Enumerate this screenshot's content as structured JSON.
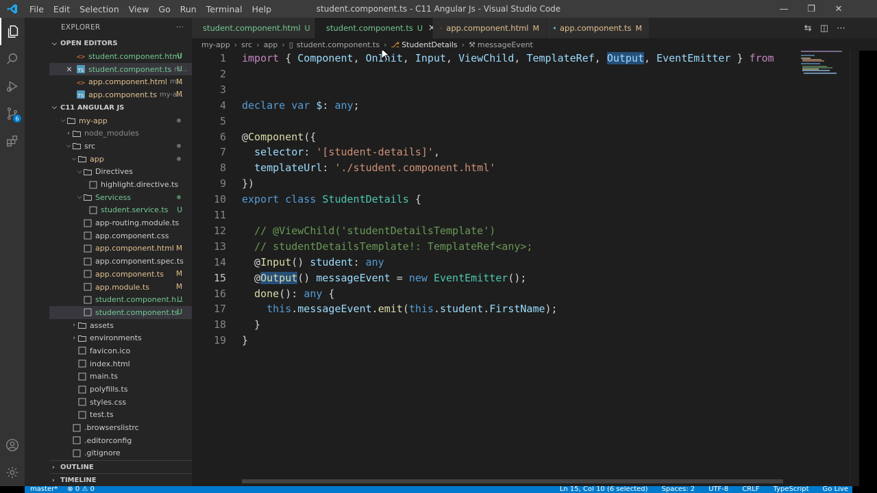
{
  "window": {
    "title": "student.component.ts - C11 Angular Js - Visual Studio Code",
    "menu": [
      "File",
      "Edit",
      "Selection",
      "View",
      "Go",
      "Run",
      "Terminal",
      "Help"
    ]
  },
  "activity": {
    "items": [
      "files-icon",
      "search-icon",
      "run-debug-icon",
      "source-control-icon",
      "extensions-icon"
    ],
    "scm_badge": "6"
  },
  "sidebar": {
    "title": "EXPLORER",
    "more": "···",
    "open_editors": {
      "label": "OPEN EDITORS",
      "items": [
        {
          "name": "student.component.html",
          "desc": "",
          "status": "U"
        },
        {
          "name": "student.component.ts",
          "desc": "m...",
          "status": "U"
        },
        {
          "name": "app.component.html",
          "desc": "m...",
          "status": "M"
        },
        {
          "name": "app.component.ts",
          "desc": "my-a...",
          "status": "M"
        }
      ]
    },
    "workspace": {
      "label": "C11 ANGULAR JS",
      "tree": [
        {
          "name": "my-app",
          "status": ""
        },
        {
          "name": "node_modules",
          "status": ""
        },
        {
          "name": "src",
          "status": ""
        },
        {
          "name": "app",
          "status": ""
        },
        {
          "name": "Directives",
          "status": ""
        },
        {
          "name": "highlight.directive.ts",
          "status": ""
        },
        {
          "name": "Servicess",
          "status": ""
        },
        {
          "name": "student.service.ts",
          "status": "U"
        },
        {
          "name": "app-routing.module.ts",
          "status": ""
        },
        {
          "name": "app.component.css",
          "status": ""
        },
        {
          "name": "app.component.html",
          "status": "M"
        },
        {
          "name": "app.component.spec.ts",
          "status": ""
        },
        {
          "name": "app.component.ts",
          "status": "M"
        },
        {
          "name": "app.module.ts",
          "status": "M"
        },
        {
          "name": "student.component.h...",
          "status": "U"
        },
        {
          "name": "student.component.ts",
          "status": "U"
        },
        {
          "name": "assets",
          "status": ""
        },
        {
          "name": "environments",
          "status": ""
        },
        {
          "name": "favicon.ico",
          "status": ""
        },
        {
          "name": "index.html",
          "status": ""
        },
        {
          "name": "main.ts",
          "status": ""
        },
        {
          "name": "polyfills.ts",
          "status": ""
        },
        {
          "name": "styles.css",
          "status": ""
        },
        {
          "name": "test.ts",
          "status": ""
        },
        {
          "name": ".browserslistrc",
          "status": ""
        },
        {
          "name": ".editorconfig",
          "status": ""
        },
        {
          "name": ".gitignore",
          "status": ""
        }
      ]
    },
    "outline": "OUTLINE",
    "timeline": "TIMELINE"
  },
  "tabs": [
    {
      "label": "student.component.html",
      "flag": "U"
    },
    {
      "label": "student.component.ts",
      "flag": "U"
    },
    {
      "label": "app.component.html",
      "flag": "M"
    },
    {
      "label": "app.component.ts",
      "flag": "M"
    }
  ],
  "breadcrumb": [
    "my-app",
    "src",
    "app",
    "student.component.ts",
    "StudentDetails",
    "messageEvent"
  ],
  "editor": {
    "line_numbers": [
      "1",
      "2",
      "3",
      "4",
      "5",
      "6",
      "7",
      "8",
      "9",
      "10",
      "11",
      "12",
      "13",
      "14",
      "15",
      "16",
      "17",
      "18",
      "19"
    ],
    "current_line": "15"
  },
  "statusbar": {
    "branch": "master*",
    "problems": "⊗ 0 ⚠ 0",
    "position": "Ln 15, Col 10 (6 selected)",
    "spaces": "Spaces: 2",
    "encoding": "UTF-8",
    "eol": "CRLF",
    "language": "TypeScript",
    "golive": "Go Live"
  }
}
